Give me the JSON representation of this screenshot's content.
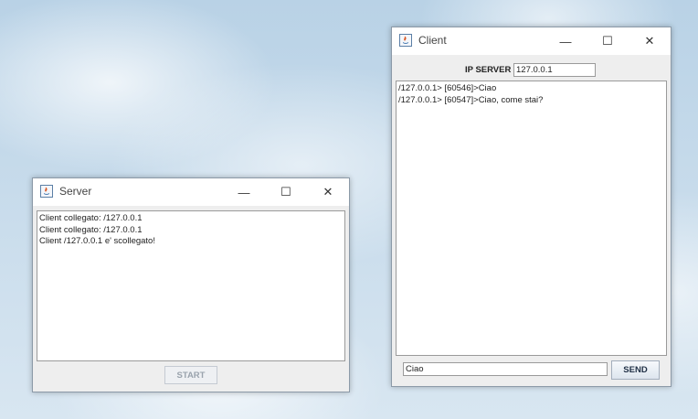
{
  "server_window": {
    "title": "Server",
    "log_lines": [
      "Client collegato: /127.0.0.1",
      "Client collegato: /127.0.0.1",
      "Client /127.0.0.1 e' scollegato!"
    ],
    "start_label": "START"
  },
  "client_window": {
    "title": "Client",
    "ip_label": "IP SERVER",
    "ip_value": "127.0.0.1",
    "chat_lines": [
      "/127.0.0.1> [60546]>Ciao",
      "/127.0.0.1> [60547]>Ciao, come stai?"
    ],
    "message_value": "Ciao",
    "send_label": "SEND"
  },
  "window_controls": {
    "minimize": "—",
    "maximize": "☐",
    "close": "✕"
  }
}
